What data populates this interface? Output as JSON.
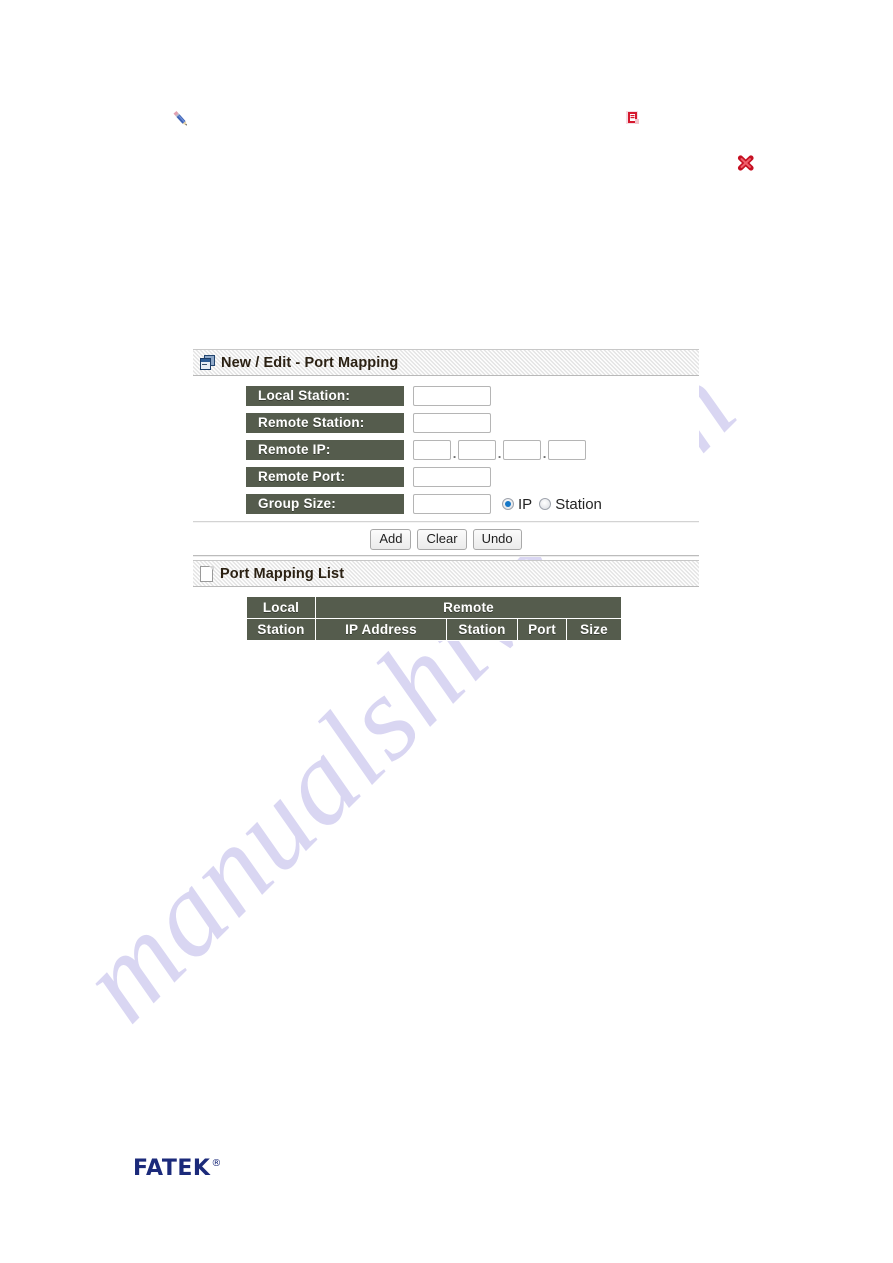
{
  "page": {
    "watermark": "manualshive.com"
  },
  "floating_icons": [
    {
      "name": "pencil-icon",
      "title": "Edit"
    },
    {
      "name": "red-document-icon",
      "title": "Delete record"
    },
    {
      "name": "red-x-icon",
      "title": "Delete"
    }
  ],
  "new_edit_panel": {
    "icon": "form-window-icon",
    "title": "New / Edit - Port Mapping",
    "fields": [
      {
        "label": "Local Station:",
        "value": "",
        "placeholder": ""
      },
      {
        "label": "Remote Station:",
        "value": "",
        "placeholder": ""
      },
      {
        "label": "Remote IP:",
        "value": "",
        "placeholder": ""
      },
      {
        "label": "Remote Port:",
        "value": "",
        "placeholder": ""
      },
      {
        "label": "Group Size:",
        "value": "",
        "placeholder": ""
      }
    ],
    "ip_octets": [
      "",
      "",
      "",
      ""
    ],
    "ip_separator": ".",
    "group_size_mode": {
      "options": [
        {
          "label": "IP",
          "selected": true
        },
        {
          "label": "Station",
          "selected": false
        }
      ]
    },
    "buttons": [
      {
        "label": "Add"
      },
      {
        "label": "Clear"
      },
      {
        "label": "Undo"
      }
    ]
  },
  "list_panel": {
    "icon": "page-icon",
    "title": "Port Mapping List",
    "table": {
      "group_headers": [
        {
          "label": "Local",
          "colspan": 1
        },
        {
          "label": "Remote",
          "colspan": 4
        }
      ],
      "column_headers": [
        "Station",
        "IP Address",
        "Station",
        "Port",
        "Size"
      ],
      "rows": []
    }
  },
  "footer": {
    "brand": "FATEK",
    "registered_mark": "®"
  },
  "colors": {
    "label_bg": "#555c4d",
    "label_text": "#ffffff",
    "panel_header_bg": "#e4e4e4",
    "radio_accent": "#1678c8",
    "brand": "#1b2a7a",
    "watermark": "#d9d6f2"
  }
}
